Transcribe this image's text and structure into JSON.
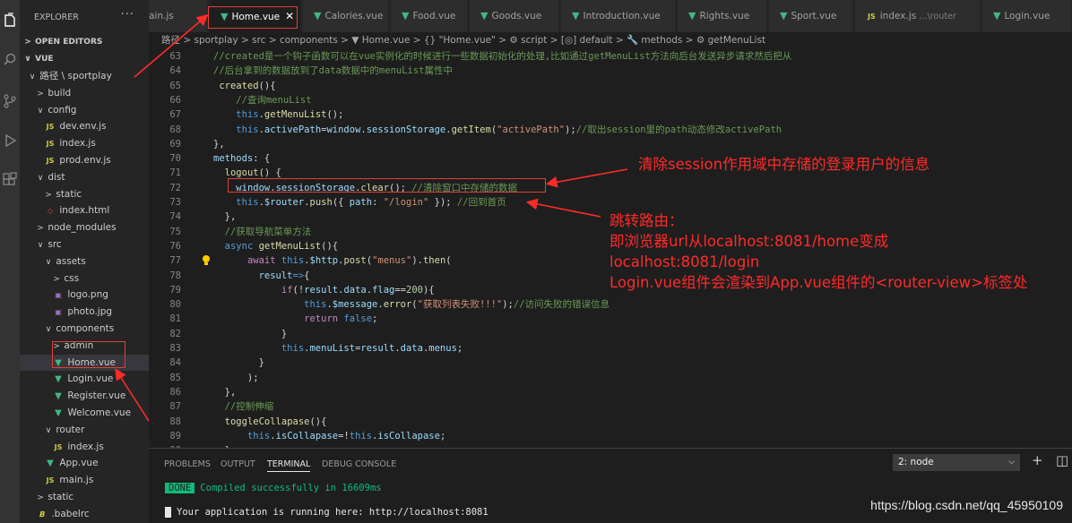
{
  "sidebar": {
    "header": "EXPLORER",
    "menu": "···",
    "open_editors": "OPEN EDITORS",
    "project": "VUE",
    "tree": [
      {
        "label": "路径 \\ sportplay",
        "arrow": "∨",
        "type": "folder",
        "depth": 1
      },
      {
        "label": "build",
        "arrow": ">",
        "type": "folder",
        "depth": 2
      },
      {
        "label": "config",
        "arrow": "∨",
        "type": "folder",
        "depth": 2
      },
      {
        "label": "dev.env.js",
        "type": "js",
        "depth": 3
      },
      {
        "label": "index.js",
        "type": "js",
        "depth": 3
      },
      {
        "label": "prod.env.js",
        "type": "js",
        "depth": 3
      },
      {
        "label": "dist",
        "arrow": "∨",
        "type": "folder",
        "depth": 2
      },
      {
        "label": "static",
        "arrow": ">",
        "type": "folder",
        "depth": 3
      },
      {
        "label": "index.html",
        "type": "html",
        "depth": 3
      },
      {
        "label": "node_modules",
        "arrow": ">",
        "type": "folder",
        "depth": 2
      },
      {
        "label": "src",
        "arrow": "∨",
        "type": "folder",
        "depth": 2
      },
      {
        "label": "assets",
        "arrow": "∨",
        "type": "folder",
        "depth": 3
      },
      {
        "label": "css",
        "arrow": ">",
        "type": "folder",
        "depth": 4
      },
      {
        "label": "logo.png",
        "type": "img",
        "depth": 4
      },
      {
        "label": "photo.jpg",
        "type": "img",
        "depth": 4
      },
      {
        "label": "components",
        "arrow": "∨",
        "type": "folder",
        "depth": 3
      },
      {
        "label": "admin",
        "arrow": ">",
        "type": "folder",
        "depth": 4
      },
      {
        "label": "Home.vue",
        "type": "vue",
        "depth": 4,
        "active": true
      },
      {
        "label": "Login.vue",
        "type": "vue",
        "depth": 4
      },
      {
        "label": "Register.vue",
        "type": "vue",
        "depth": 4
      },
      {
        "label": "Welcome.vue",
        "type": "vue",
        "depth": 4
      },
      {
        "label": "router",
        "arrow": "∨",
        "type": "folder",
        "depth": 3
      },
      {
        "label": "index.js",
        "type": "js",
        "depth": 4
      },
      {
        "label": "App.vue",
        "type": "vue",
        "depth": 3
      },
      {
        "label": "main.js",
        "type": "js",
        "depth": 3
      },
      {
        "label": "static",
        "arrow": ">",
        "type": "folder",
        "depth": 2
      },
      {
        "label": ".babelrc",
        "type": "rc",
        "depth": 2
      }
    ]
  },
  "tabs": [
    {
      "label": "ain.js",
      "icon": "none"
    },
    {
      "label": "Home.vue",
      "icon": "vue",
      "active": true,
      "close": "✕"
    },
    {
      "label": "Calories.vue",
      "icon": "vue"
    },
    {
      "label": "Food.vue",
      "icon": "vue"
    },
    {
      "label": "Goods.vue",
      "icon": "vue"
    },
    {
      "label": "Introduction.vue",
      "icon": "vue"
    },
    {
      "label": "Rights.vue",
      "icon": "vue"
    },
    {
      "label": "Sport.vue",
      "icon": "vue"
    },
    {
      "label": "index.js",
      "icon": "js",
      "hint": "...\\router"
    },
    {
      "label": "Login.vue",
      "icon": "vue"
    }
  ],
  "breadcrumb": "路径 > sportplay > src > components > ▼ Home.vue > {} \"Home.vue\" > ⚙ script > [◎] default > 🔧 methods > ⚙ getMenuList",
  "code": [
    {
      "n": "63",
      "t": [
        [
          "c-cm",
          "//created是一个钩子函数可以在vue实例化的时候进行一些数据初始化的处理,比如通过getMenuList方法向后台发送异步请求然后把从"
        ]
      ]
    },
    {
      "n": "64",
      "t": [
        [
          "c-cm",
          "//后台拿到的数据放到了data数据中的menuList属性中"
        ]
      ]
    },
    {
      "n": "65",
      "t": [
        [
          "c-tx",
          " "
        ],
        [
          "c-fn",
          "created"
        ],
        [
          "c-tx",
          "(){"
        ]
      ]
    },
    {
      "n": "66",
      "t": [
        [
          "c-tx",
          "    "
        ],
        [
          "c-cm",
          "//查询menuList"
        ]
      ]
    },
    {
      "n": "67",
      "t": [
        [
          "c-tx",
          "    "
        ],
        [
          "c-kw",
          "this"
        ],
        [
          "c-tx",
          "."
        ],
        [
          "c-fn",
          "getMenuList"
        ],
        [
          "c-tx",
          "();"
        ]
      ]
    },
    {
      "n": "68",
      "t": [
        [
          "c-tx",
          "    "
        ],
        [
          "c-kw",
          "this"
        ],
        [
          "c-tx",
          "."
        ],
        [
          "c-pr",
          "activePath"
        ],
        [
          "c-tx",
          "="
        ],
        [
          "c-pr",
          "window"
        ],
        [
          "c-tx",
          "."
        ],
        [
          "c-pr",
          "sessionStorage"
        ],
        [
          "c-tx",
          "."
        ],
        [
          "c-fn",
          "getItem"
        ],
        [
          "c-tx",
          "("
        ],
        [
          "c-st",
          "\"activePath\""
        ],
        [
          "c-tx",
          ");"
        ],
        [
          "c-cm",
          "//取出session里的path动态修改activePath"
        ]
      ]
    },
    {
      "n": "69",
      "t": [
        [
          "c-tx",
          "},"
        ]
      ]
    },
    {
      "n": "70",
      "t": [
        [
          "c-pr",
          "methods"
        ],
        [
          "c-tx",
          ": {"
        ]
      ]
    },
    {
      "n": "71",
      "t": [
        [
          "c-tx",
          "  "
        ],
        [
          "c-fn",
          "logout"
        ],
        [
          "c-tx",
          "() {"
        ]
      ]
    },
    {
      "n": "72",
      "t": [
        [
          "c-tx",
          "    "
        ],
        [
          "c-pr",
          "window"
        ],
        [
          "c-tx",
          "."
        ],
        [
          "c-pr",
          "sessionStorage"
        ],
        [
          "c-tx",
          "."
        ],
        [
          "c-fn",
          "clear"
        ],
        [
          "c-tx",
          "(); "
        ],
        [
          "c-cm",
          "//清除窗口中存储的数据"
        ]
      ]
    },
    {
      "n": "73",
      "t": [
        [
          "c-tx",
          "    "
        ],
        [
          "c-kw",
          "this"
        ],
        [
          "c-tx",
          "."
        ],
        [
          "c-pr",
          "$router"
        ],
        [
          "c-tx",
          "."
        ],
        [
          "c-fn",
          "push"
        ],
        [
          "c-tx",
          "({ "
        ],
        [
          "c-pr",
          "path"
        ],
        [
          "c-tx",
          ": "
        ],
        [
          "c-st",
          "\"/login\""
        ],
        [
          "c-tx",
          " }); "
        ],
        [
          "c-cm",
          "//回到首页"
        ]
      ]
    },
    {
      "n": "74",
      "t": [
        [
          "c-tx",
          "  },"
        ]
      ]
    },
    {
      "n": "75",
      "t": [
        [
          "c-tx",
          "  "
        ],
        [
          "c-cm",
          "//获取导航菜单方法"
        ]
      ]
    },
    {
      "n": "76",
      "t": [
        [
          "c-tx",
          "  "
        ],
        [
          "c-kw",
          "async"
        ],
        [
          "c-tx",
          " "
        ],
        [
          "c-fn",
          "getMenuList"
        ],
        [
          "c-tx",
          "(){"
        ]
      ]
    },
    {
      "n": "77",
      "t": [
        [
          "c-tx",
          "      "
        ],
        [
          "c-ctl",
          "await"
        ],
        [
          "c-tx",
          " "
        ],
        [
          "c-kw",
          "this"
        ],
        [
          "c-tx",
          "."
        ],
        [
          "c-pr",
          "$http"
        ],
        [
          "c-tx",
          "."
        ],
        [
          "c-fn",
          "post"
        ],
        [
          "c-tx",
          "("
        ],
        [
          "c-st",
          "\"menus\""
        ],
        [
          "c-tx",
          ")."
        ],
        [
          "c-fn",
          "then"
        ],
        [
          "c-tx",
          "("
        ]
      ]
    },
    {
      "n": "78",
      "t": [
        [
          "c-tx",
          "        "
        ],
        [
          "c-pr",
          "result"
        ],
        [
          "c-kw",
          "=>"
        ],
        [
          "c-tx",
          "{"
        ]
      ]
    },
    {
      "n": "79",
      "t": [
        [
          "c-tx",
          "            "
        ],
        [
          "c-ctl",
          "if"
        ],
        [
          "c-tx",
          "(!"
        ],
        [
          "c-pr",
          "result"
        ],
        [
          "c-tx",
          "."
        ],
        [
          "c-pr",
          "data"
        ],
        [
          "c-tx",
          "."
        ],
        [
          "c-pr",
          "flag"
        ],
        [
          "c-tx",
          "=="
        ],
        [
          "c-nm",
          "200"
        ],
        [
          "c-tx",
          "){"
        ]
      ]
    },
    {
      "n": "80",
      "t": [
        [
          "c-tx",
          "                "
        ],
        [
          "c-kw",
          "this"
        ],
        [
          "c-tx",
          "."
        ],
        [
          "c-pr",
          "$message"
        ],
        [
          "c-tx",
          "."
        ],
        [
          "c-fn",
          "error"
        ],
        [
          "c-tx",
          "("
        ],
        [
          "c-st",
          "\"获取列表失败!!!\""
        ],
        [
          "c-tx",
          ");"
        ],
        [
          "c-cm",
          "//访问失败的错误信息"
        ]
      ]
    },
    {
      "n": "81",
      "t": [
        [
          "c-tx",
          "                "
        ],
        [
          "c-ctl",
          "return"
        ],
        [
          "c-tx",
          " "
        ],
        [
          "c-kw",
          "false"
        ],
        [
          "c-tx",
          ";"
        ]
      ]
    },
    {
      "n": "82",
      "t": [
        [
          "c-tx",
          "            }"
        ]
      ]
    },
    {
      "n": "83",
      "t": [
        [
          "c-tx",
          "            "
        ],
        [
          "c-kw",
          "this"
        ],
        [
          "c-tx",
          "."
        ],
        [
          "c-pr",
          "menuList"
        ],
        [
          "c-tx",
          "="
        ],
        [
          "c-pr",
          "result"
        ],
        [
          "c-tx",
          "."
        ],
        [
          "c-pr",
          "data"
        ],
        [
          "c-tx",
          "."
        ],
        [
          "c-pr",
          "menus"
        ],
        [
          "c-tx",
          ";"
        ]
      ]
    },
    {
      "n": "84",
      "t": [
        [
          "c-tx",
          "        }"
        ]
      ]
    },
    {
      "n": "85",
      "t": [
        [
          "c-tx",
          "      );"
        ]
      ]
    },
    {
      "n": "86",
      "t": [
        [
          "c-tx",
          "  },"
        ]
      ]
    },
    {
      "n": "87",
      "t": [
        [
          "c-tx",
          "  "
        ],
        [
          "c-cm",
          "//控制伸缩"
        ]
      ]
    },
    {
      "n": "88",
      "t": [
        [
          "c-tx",
          "  "
        ],
        [
          "c-fn",
          "toggleCollapase"
        ],
        [
          "c-tx",
          "(){"
        ]
      ]
    },
    {
      "n": "89",
      "t": [
        [
          "c-tx",
          "      "
        ],
        [
          "c-kw",
          "this"
        ],
        [
          "c-tx",
          "."
        ],
        [
          "c-pr",
          "isCollapase"
        ],
        [
          "c-tx",
          "=!"
        ],
        [
          "c-kw",
          "this"
        ],
        [
          "c-tx",
          "."
        ],
        [
          "c-pr",
          "isCollapase"
        ],
        [
          "c-tx",
          ";"
        ]
      ]
    },
    {
      "n": "90",
      "t": [
        [
          "c-tx",
          "  }"
        ]
      ]
    }
  ],
  "panel": {
    "tabs": [
      "PROBLEMS",
      "OUTPUT",
      "TERMINAL",
      "DEBUG CONSOLE"
    ],
    "active_tab": "TERMINAL",
    "terminal_select": "2: node",
    "add": "+",
    "split": "◫",
    "done_badge": "DONE",
    "compiled": "Compiled successfully in 16609ms",
    "running": "Your application is running here: http://localhost:8081"
  },
  "annotations": {
    "clear_session": "清除session作用域中存储的登录用户的信息",
    "route_lines": [
      "跳转路由：",
      "即浏览器url从localhost:8081/home变成",
      "localhost:8081/login",
      "Login.vue组件会渲染到App.vue组件的<router-view>标签处"
    ]
  },
  "watermark": "https://blog.csdn.net/qq_45950109",
  "colors": {
    "annotation": "#ff2a2a",
    "vue_icon": "#41b883",
    "js_icon": "#cbcb41"
  }
}
